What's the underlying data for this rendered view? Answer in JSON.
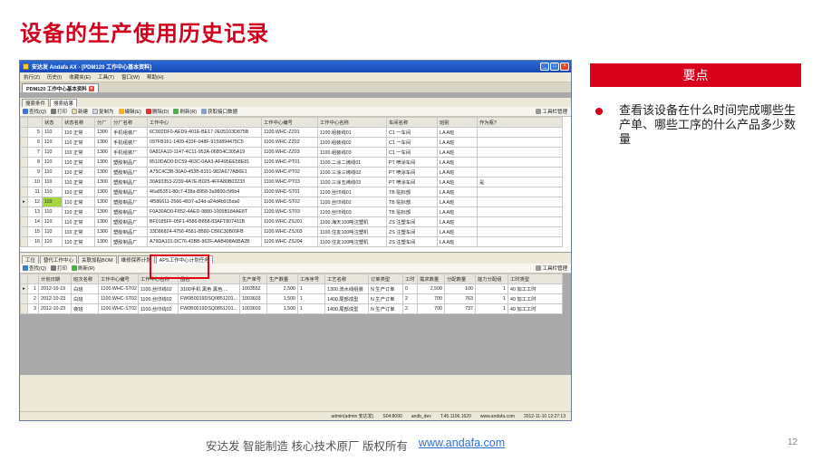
{
  "slide": {
    "title": "设备的生产使用历史记录",
    "keypoint_label": "要点",
    "point_text": "查看该设备在什么时间完成哪些生产单、哪些工序的什么产品多少数量",
    "footer_text": "安达发 智能制造 核心技术原厂 版权所有",
    "footer_link": "www.andafa.com",
    "page_number": "12"
  },
  "window": {
    "title": "安达发 Andafa AX - [PDM120 工作中心基本资料]",
    "menu": [
      "执行(Z)",
      "历史(I)",
      "收藏夹(E)",
      "工具(T)",
      "窗口(W)",
      "帮助(H)"
    ],
    "doc_tab": "PDM120 工作中心基本资料",
    "subtabs": [
      "搜索条件",
      "搜索结果"
    ],
    "toolbar": [
      "查找(Q)",
      "打印",
      "新建",
      "复制为",
      "编辑(E)",
      "删除(D)",
      "刷新(R)",
      "获取接口数据"
    ],
    "toolbar_right": "工具栏管理",
    "status": [
      "admin(admin 安达发)",
      "S04:8090",
      "andb_dev",
      "T.45.1106.1620",
      "www.andafa.com",
      "2012-11-10 12:27:13"
    ]
  },
  "grid1": {
    "columns": [
      "",
      "",
      "状态",
      "状态名称",
      "分厂",
      "分厂名称",
      "工作中心",
      "工作中心编号",
      "工作中心名称",
      "车间名称",
      "班别",
      "作为瓶?"
    ],
    "rows": [
      [
        "",
        "5",
        "110",
        "110 正常",
        "1300",
        "手机组装厂",
        "6C902DF0-AED9-401E-BE17-2E05103D875B",
        "1100.WHC-ZZ01",
        "1100.组装线01",
        "C1 一车间",
        "LA A班",
        ""
      ],
      [
        "",
        "6",
        "110",
        "110 正常",
        "1300",
        "手机组装厂",
        "097FB161-1409-433F-048F-9159894475C5",
        "1100.WHC-ZZ02",
        "1100.组装线02",
        "C1 一车间",
        "LA A班",
        ""
      ],
      [
        "",
        "7",
        "110",
        "110 正常",
        "1300",
        "手机组装厂",
        "0A81FA10-1147-4C11-953A-06B54C305A19",
        "1100.WHC-ZZ03",
        "1100.组装线03",
        "C1 一车间",
        "LA A班",
        ""
      ],
      [
        "",
        "8",
        "110",
        "110 正常",
        "1300",
        "塑胶制品厂",
        "8510DAD0-DC59-463C-0AA3-AF495EE58E81",
        "1100.WHC-PT01",
        "1100.二涂二烤线01",
        "PT 喷涂车间",
        "LA A班",
        ""
      ],
      [
        "",
        "9",
        "110",
        "110 正常",
        "1300",
        "塑胶制品厂",
        "A75C4C3B-30A0-453B-8151-982A677AB6E1",
        "1100.WHC-PT02",
        "1100.三涂三烤线02",
        "PT 喷涂车间",
        "LA A班",
        ""
      ],
      [
        "",
        "10",
        "110",
        "110 正常",
        "1300",
        "塑胶制品厂",
        "30A93353-2239-4A7E-B025-4FFA80B03233",
        "1100.WHC-PT03",
        "1100.三涂五烤线03",
        "PT 喷涂车间",
        "LA A班",
        "是"
      ],
      [
        "",
        "11",
        "110",
        "110 正常",
        "1300",
        "塑胶制品厂",
        "46a85351-80c7-438a-8958-3a9800c5f6b4",
        "1100.WHC-ST01",
        "1100.丝印线01",
        "TB 贴标部",
        "LA A班",
        ""
      ],
      [
        "▸",
        "12",
        "110",
        "110 正常",
        "1300",
        "塑胶制品厂",
        "4f586611-2566-4837-a24d-a24d4b915da0",
        "1100.WHC-ST02",
        "1100.丝印线02",
        "TB 贴标部",
        "LA A班",
        ""
      ],
      [
        "",
        "13",
        "110",
        "110 正常",
        "1300",
        "塑胶制品厂",
        "F0A30AD0-F852-4AED-9880-1005B184AE8T",
        "1100.WHC-ST03",
        "1100.丝印线03",
        "TB 贴标部",
        "LA A班",
        ""
      ],
      [
        "",
        "14",
        "110",
        "110 正常",
        "1300",
        "塑胶制品厂",
        "BF0185FF-05F1-4586-B858-83AFT807411B",
        "1100.WHC-ZSJ01",
        "1100.海天100吨注塑机",
        "ZS 注塑车间",
        "LA A班",
        ""
      ],
      [
        "",
        "15",
        "110",
        "110 正常",
        "1300",
        "塑胶制品厂",
        "33D86824-4756-4581-8B80-CB6C30B09FB",
        "1100.WHC-ZSJ03",
        "1100.住友100吨注塑机",
        "ZS 注塑车间",
        "LA A班",
        ""
      ],
      [
        "",
        "16",
        "110",
        "110 正常",
        "1300",
        "塑胶制品厂",
        "A79DA101-DC76-43BB-962F-AAB498A6BA2B",
        "1100.WHC-ZSJ04",
        "1100.住友100吨注塑机",
        "ZS 注塑车间",
        "LA A班",
        ""
      ]
    ]
  },
  "bottom_tabs": [
    "工位",
    "替代工作中心",
    "关联加贴BOM",
    "维修保养计划",
    "APS工作中心计划任务"
  ],
  "grid2": {
    "toolbar": [
      "查找(Q)",
      "打印",
      "刷新(R)"
    ],
    "toolbar_right": "工具栏管理",
    "columns": [
      "",
      "",
      "计划日期",
      "班次名称",
      "工作中心编号",
      "工作中心名称",
      "品名",
      "生产单号",
      "生产数量",
      "工序序号",
      "工艺名称",
      "订单类型",
      "工时",
      "需求数量",
      "分配数量",
      "能力分配组",
      "工时类型"
    ],
    "rows": [
      [
        "▸",
        "1",
        "2012-10-19",
        "白班",
        "1100.WHC-ST02",
        "1100.丝印线02",
        "3100手机 黑色 黑色 ...",
        "1003552",
        "2,500",
        "1",
        "1300.流水线组装",
        "N 生产订单",
        "0",
        "2,500",
        "100",
        "1",
        "40 加工工时"
      ],
      [
        "",
        "2",
        "2012-10-23",
        "白班",
        "1100.WHC-ST02",
        "1100.丝印线02",
        "FW0B0019DSQ0851201...",
        "1003603",
        "1,500",
        "1",
        "1400.尾部成型",
        "N 生产订单",
        "2",
        "700",
        "763",
        "1",
        "40 加工工时"
      ],
      [
        "",
        "3",
        "2012-10-23",
        "夜班",
        "1100.WHC-ST02",
        "1100.丝印线02",
        "FW0B0019DSQ0851201...",
        "1003603",
        "1,500",
        "1",
        "1400.尾部成型",
        "N 生产订单",
        "2",
        "700",
        "737",
        "1",
        "40 加工工时"
      ]
    ]
  }
}
